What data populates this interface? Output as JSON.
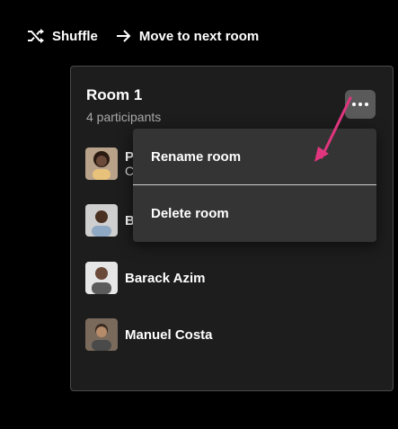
{
  "toolbar": {
    "shuffle_label": "Shuffle",
    "move_label": "Move to next room"
  },
  "room": {
    "title": "Room 1",
    "subtitle": "4 participants",
    "more_icon": "more-horizontal-icon"
  },
  "participants": [
    {
      "name": "P",
      "sub": "C",
      "avatar_bg": "#6b4a3a"
    },
    {
      "name": "B",
      "sub": "",
      "avatar_bg": "#8a8a8a"
    },
    {
      "name": "Barack Azim",
      "sub": "",
      "avatar_bg": "#5b5b5b"
    },
    {
      "name": "Manuel Costa",
      "sub": "",
      "avatar_bg": "#6e5b4d"
    }
  ],
  "menu": {
    "items": [
      "Rename room",
      "Delete room"
    ]
  },
  "colors": {
    "background": "#000000",
    "card": "#1d1d1d",
    "menu": "#343434",
    "arrow": "#e0357f"
  }
}
